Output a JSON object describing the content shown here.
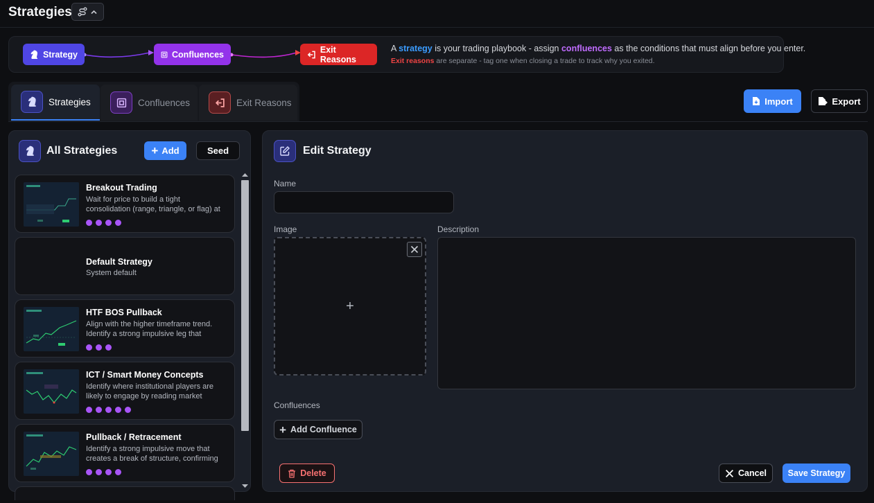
{
  "header": {
    "title": "Strategies",
    "toggle_icon": "route-icon"
  },
  "flow": {
    "steps": [
      {
        "label": "Strategy",
        "color": "#4f46e5"
      },
      {
        "label": "Confluences",
        "color": "#9333ea"
      },
      {
        "label": "Exit Reasons",
        "color": "#dc2626"
      }
    ],
    "line1": {
      "a": "A ",
      "strategy": "strategy",
      "b": " is your trading playbook - assign ",
      "confluences": "confluences",
      "c": " as the conditions that must align before you enter."
    },
    "line2": {
      "exit": "Exit reasons",
      "rest": " are separate - tag one when closing a trade to track why you exited."
    }
  },
  "tabs": [
    {
      "label": "Strategies",
      "active": true
    },
    {
      "label": "Confluences",
      "active": false
    },
    {
      "label": "Exit Reasons",
      "active": false
    }
  ],
  "toolbar": {
    "import_label": "Import",
    "export_label": "Export"
  },
  "left_panel": {
    "title": "All Strategies",
    "add_label": "Add",
    "seed_label": "Seed",
    "strategies": [
      {
        "name": "Breakout Trading",
        "desc": "Wait for price to build a tight consolidation (range, triangle, or flag) at",
        "confluences": 4,
        "has_image": true
      },
      {
        "name": "Default Strategy",
        "desc": "System default",
        "confluences": 0,
        "has_image": false
      },
      {
        "name": "HTF BOS Pullback",
        "desc": "Align with the higher timeframe trend. Identify a strong impulsive leg that",
        "confluences": 3,
        "has_image": true
      },
      {
        "name": "ICT / Smart Money Concepts",
        "desc": "Identify where institutional players are likely to engage by reading market",
        "confluences": 5,
        "has_image": true
      },
      {
        "name": "Pullback / Retracement",
        "desc": "Identify a strong impulsive move that creates a break of structure, confirming",
        "confluences": 4,
        "has_image": true
      }
    ]
  },
  "editor": {
    "title": "Edit Strategy",
    "name_label": "Name",
    "name_value": "",
    "image_label": "Image",
    "description_label": "Description",
    "description_value": "",
    "confluences_label": "Confluences",
    "add_confluence_label": "Add Confluence",
    "delete_label": "Delete",
    "cancel_label": "Cancel",
    "save_label": "Save Strategy"
  },
  "colors": {
    "accent": "#3b82f6",
    "confluence_dot": "#a855f7",
    "danger": "#f87171"
  }
}
